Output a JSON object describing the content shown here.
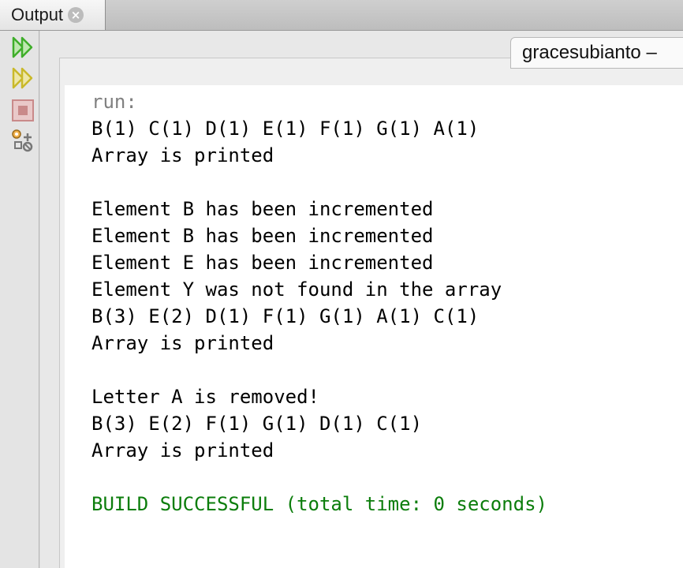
{
  "tab": {
    "label": "Output",
    "close_icon": "close-circle-icon"
  },
  "toolbar": {
    "tools": [
      {
        "name": "rerun-icon",
        "color": "#3fae2a"
      },
      {
        "name": "rerun-with-params-icon",
        "color": "#c9b92a"
      },
      {
        "name": "stop-icon",
        "color": "#c98a8a"
      },
      {
        "name": "settings-icon",
        "color": "#777777"
      }
    ]
  },
  "subtab": {
    "label": "gracesubianto –"
  },
  "console": {
    "lines": [
      {
        "text": "run:",
        "kind": "run"
      },
      {
        "text": "B(1) C(1) D(1) E(1) F(1) G(1) A(1)",
        "kind": "normal"
      },
      {
        "text": "Array is printed",
        "kind": "normal"
      },
      {
        "text": "",
        "kind": "normal"
      },
      {
        "text": "Element B has been incremented",
        "kind": "normal"
      },
      {
        "text": "Element B has been incremented",
        "kind": "normal"
      },
      {
        "text": "Element E has been incremented",
        "kind": "normal"
      },
      {
        "text": "Element Y was not found in the array",
        "kind": "normal"
      },
      {
        "text": "B(3) E(2) D(1) F(1) G(1) A(1) C(1)",
        "kind": "normal"
      },
      {
        "text": "Array is printed",
        "kind": "normal"
      },
      {
        "text": "",
        "kind": "normal"
      },
      {
        "text": "Letter A is removed!",
        "kind": "normal"
      },
      {
        "text": "B(3) E(2) F(1) G(1) D(1) C(1)",
        "kind": "normal"
      },
      {
        "text": "Array is printed",
        "kind": "normal"
      },
      {
        "text": "",
        "kind": "normal"
      },
      {
        "text": "BUILD SUCCESSFUL (total time: 0 seconds)",
        "kind": "success"
      }
    ]
  },
  "colors": {
    "success": "#0b7d0b",
    "run_label": "#808080"
  }
}
